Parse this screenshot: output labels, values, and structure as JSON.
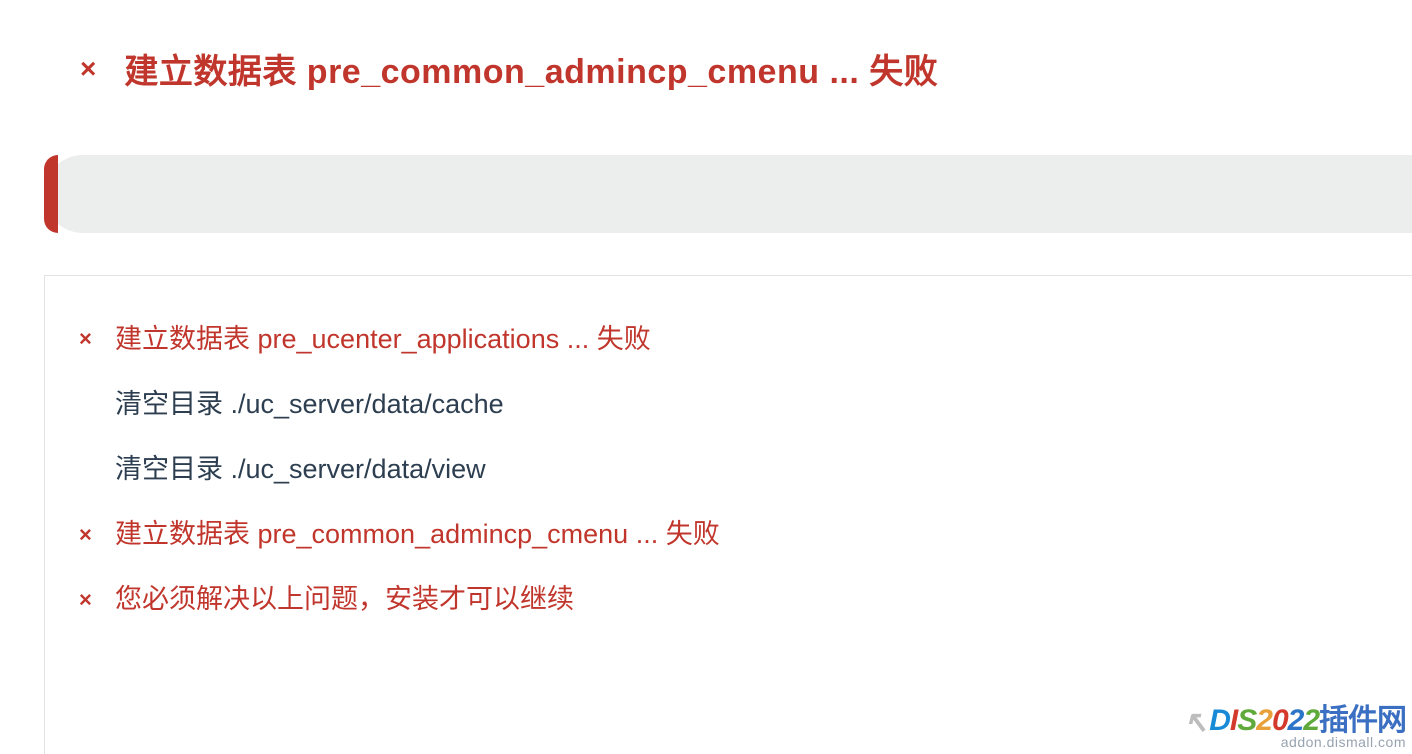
{
  "colors": {
    "error": "#c1362c",
    "info": "#2c3e50",
    "track": "#eceded",
    "border": "#e3e3e3"
  },
  "heading": {
    "icon": "×",
    "text": "建立数据表 pre_common_admincp_cmenu ... 失败"
  },
  "progress": {
    "percent": 1
  },
  "log": {
    "rows": [
      {
        "type": "error",
        "icon": "×",
        "text": "建立数据表 pre_ucenter_applications ... 失败"
      },
      {
        "type": "info",
        "icon": "",
        "text": "清空目录 ./uc_server/data/cache"
      },
      {
        "type": "info",
        "icon": "",
        "text": "清空目录 ./uc_server/data/view"
      },
      {
        "type": "error",
        "icon": "×",
        "text": "建立数据表 pre_common_admincp_cmenu ... 失败"
      },
      {
        "type": "error",
        "icon": "×",
        "text": "您必须解决以上问题，安装才可以继续"
      }
    ]
  },
  "watermark": {
    "brand_parts": {
      "cursor": "↖",
      "p1": "D",
      "p2": "I",
      "p3": "S",
      "p4": "2",
      "p5": "0",
      "p6": "2",
      "p7": "2",
      "cn": "插件网"
    },
    "sub": "addon.dismall.com"
  }
}
